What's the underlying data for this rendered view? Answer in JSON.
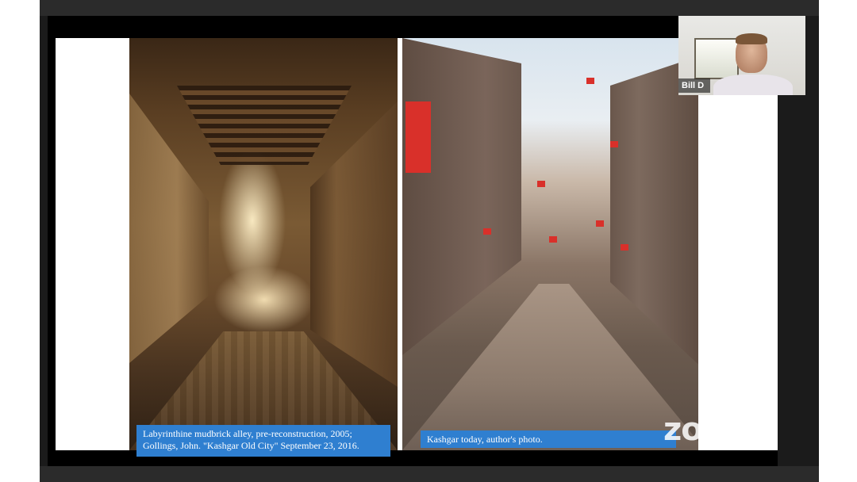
{
  "meeting": {
    "participant_name": "Bill D",
    "brand_watermark": "zoom"
  },
  "slide": {
    "left_photo": {
      "caption_line1": "Labyrinthine mudbrick alley, pre-reconstruction, 2005;",
      "caption_line2": "Gollings, John. \"Kashgar Old City\" September 23, 2016."
    },
    "right_photo": {
      "caption": "Kashgar today, author's photo."
    }
  },
  "colors": {
    "caption_bg": "#2f7fd0",
    "frame": "#1b1b1b"
  }
}
